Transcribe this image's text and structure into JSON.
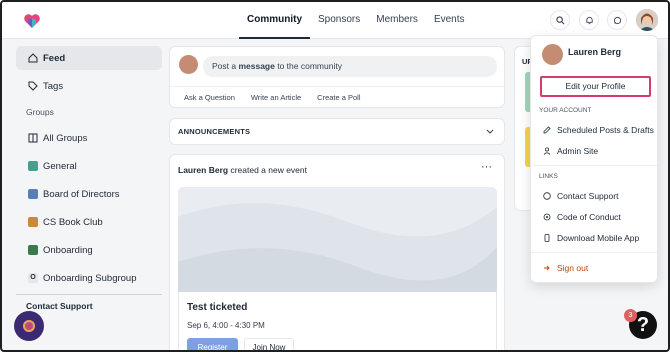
{
  "header": {
    "nav": [
      "Community",
      "Sponsors",
      "Members",
      "Events"
    ],
    "active_nav": "Community",
    "icons": [
      "search-icon",
      "bell-icon",
      "chat-icon"
    ]
  },
  "sidebar": {
    "items": [
      {
        "label": "Feed",
        "icon": "home-icon",
        "active": true
      },
      {
        "label": "Tags",
        "icon": "tag-icon"
      }
    ],
    "groups_heading": "Groups",
    "groups": [
      {
        "label": "All Groups",
        "icon": "grid-icon"
      },
      {
        "label": "General",
        "color": "#4a9d8f"
      },
      {
        "label": "Board of Directors",
        "color": "#5a7fb5"
      },
      {
        "label": "CS Book Club",
        "color": "#c98b3a"
      },
      {
        "label": "Onboarding",
        "color": "#3a7a4e"
      },
      {
        "label": "Onboarding Subgroup",
        "badge": "O"
      }
    ],
    "footer": "Contact Support"
  },
  "composer": {
    "placeholder_pre": "Post a ",
    "placeholder_bold": "message",
    "placeholder_post": " to the community",
    "actions": [
      "Ask a Question",
      "Write an Article",
      "Create a Poll"
    ]
  },
  "announcements": {
    "label": "ANNOUNCEMENTS"
  },
  "event_post": {
    "author": "Lauren Berg",
    "action": " created a new event",
    "title": "Test ticketed",
    "date": "Sep 6, 4:00 - 4:30 PM",
    "register_label": "Register",
    "join_label": "Join Now"
  },
  "right_col": {
    "heading": "UP"
  },
  "menu": {
    "user_name": "Lauren Berg",
    "edit_profile": "Edit your Profile",
    "account_heading": "YOUR ACCOUNT",
    "account_items": [
      "Scheduled Posts & Drafts",
      "Admin Site"
    ],
    "links_heading": "LINKS",
    "link_items": [
      "Contact Support",
      "Code of Conduct",
      "Download Mobile App"
    ],
    "sign_out": "Sign out",
    "highlight_color": "#d63b6b"
  },
  "help": {
    "badge": "3",
    "symbol": "?"
  }
}
